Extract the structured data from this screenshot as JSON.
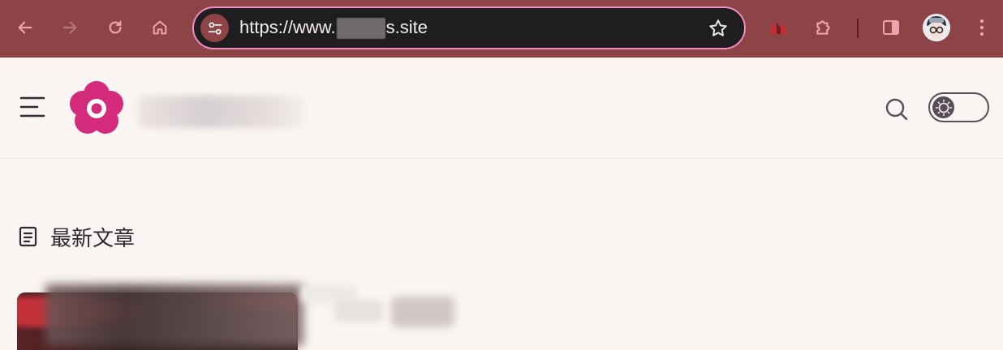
{
  "browser": {
    "url_prefix": "https://www.",
    "url_suffix": "s.site",
    "colors": {
      "frame": "#8c4446",
      "omnibox_bg": "#1f1d20",
      "omnibox_border": "#ef8ec0",
      "icon": "#f0a2ad"
    },
    "icons": [
      "back-arrow-icon",
      "forward-arrow-icon",
      "reload-icon",
      "home-icon",
      "site-settings-icon",
      "bookmark-star-icon",
      "extension-m-icon",
      "puzzle-extensions-icon",
      "side-panel-icon",
      "profile-avatar-icon",
      "more-vert-icon"
    ]
  },
  "site": {
    "brand_color": "#d42a7c",
    "text_color": "#2e2832",
    "icons": [
      "menu-icon",
      "flower-logo-icon",
      "search-icon",
      "sun-icon"
    ]
  },
  "section": {
    "title": "最新文章",
    "icon": "article-list-icon"
  }
}
